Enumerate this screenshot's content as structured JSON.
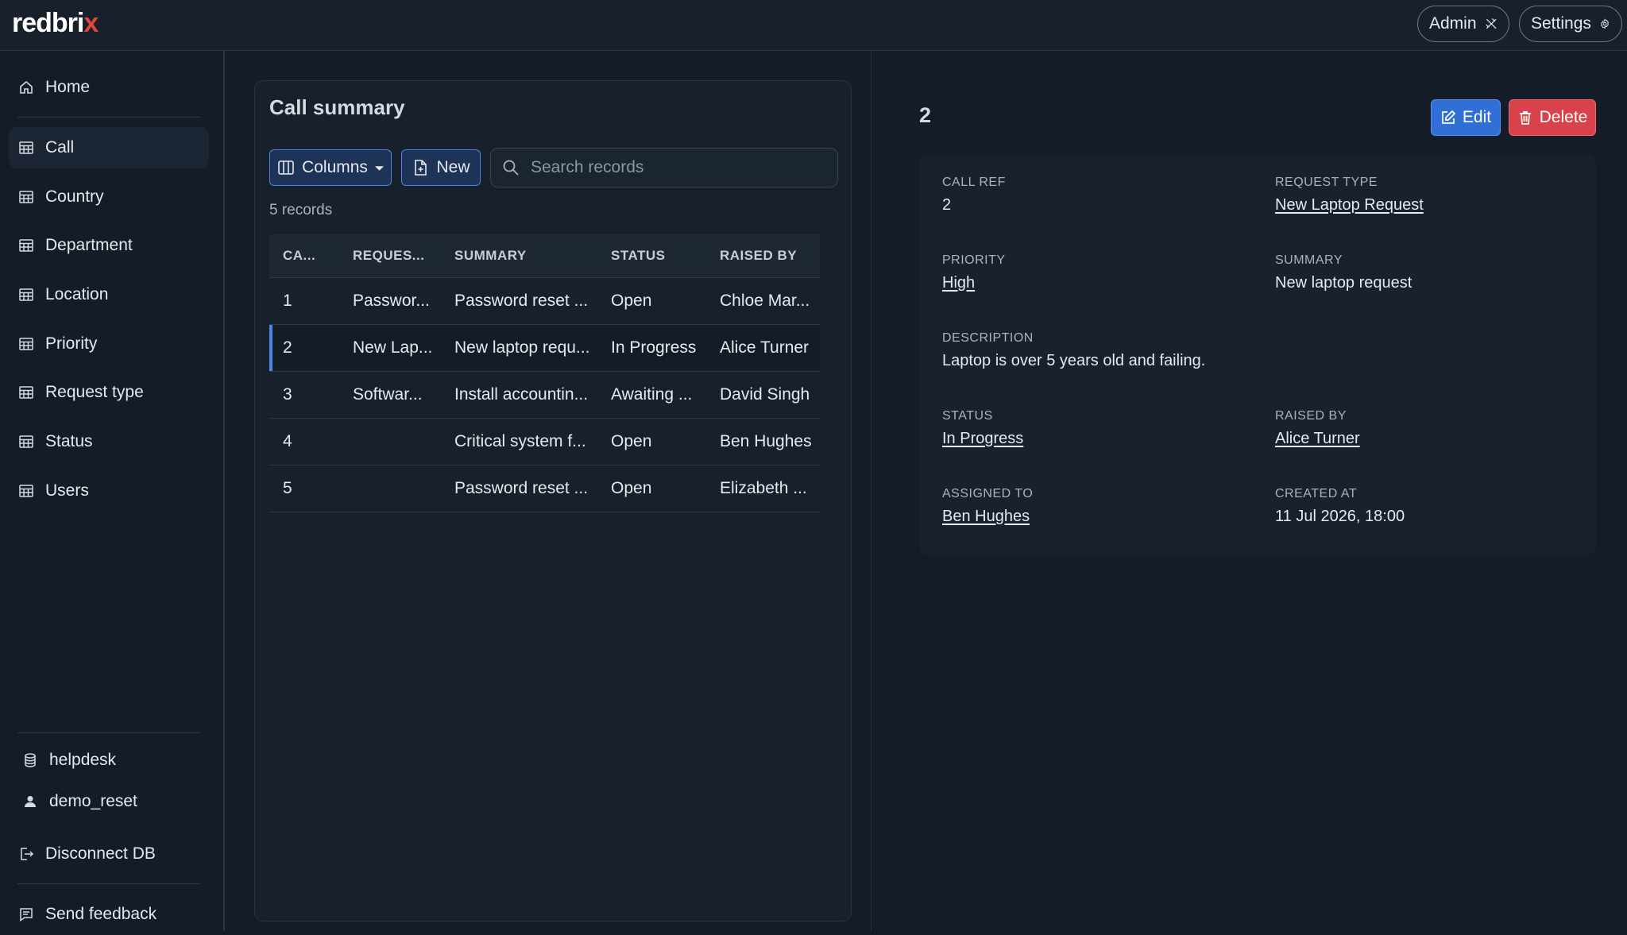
{
  "app": {
    "logo_main": "redbri",
    "logo_accent": "x",
    "admin_label": "Admin",
    "settings_label": "Settings"
  },
  "sidebar": {
    "home": "Home",
    "items": [
      "Call",
      "Country",
      "Department",
      "Location",
      "Priority",
      "Request type",
      "Status",
      "Users"
    ],
    "database": "helpdesk",
    "user": "demo_reset",
    "disconnect": "Disconnect DB",
    "feedback": "Send feedback"
  },
  "list": {
    "title": "Call summary",
    "columns_label": "Columns",
    "new_label": "New",
    "search_placeholder": "Search records",
    "record_count": "5 records",
    "headers": [
      "CA...",
      "REQUES...",
      "SUMMARY",
      "STATUS",
      "RAISED BY"
    ],
    "rows": [
      [
        "1",
        "Passwor...",
        "Password reset ...",
        "Open",
        "Chloe Mar..."
      ],
      [
        "2",
        "New Lap...",
        "New laptop requ...",
        "In Progress",
        "Alice Turner"
      ],
      [
        "3",
        "Softwar...",
        "Install accountin...",
        "Awaiting ...",
        "David Singh"
      ],
      [
        "4",
        "",
        "Critical system f...",
        "Open",
        "Ben Hughes"
      ],
      [
        "5",
        "",
        "Password reset ...",
        "Open",
        "Elizabeth ..."
      ]
    ],
    "selected_row": 1
  },
  "detail": {
    "id": "2",
    "edit_label": "Edit",
    "delete_label": "Delete",
    "fields": {
      "call_ref": {
        "label": "CALL REF",
        "value": "2"
      },
      "request_type": {
        "label": "REQUEST TYPE",
        "value": "New Laptop Request"
      },
      "priority": {
        "label": "PRIORITY",
        "value": "High"
      },
      "summary": {
        "label": "SUMMARY",
        "value": "New laptop request"
      },
      "description": {
        "label": "DESCRIPTION",
        "value": "Laptop is over 5 years old and failing."
      },
      "status": {
        "label": "STATUS",
        "value": "In Progress"
      },
      "raised_by": {
        "label": "RAISED BY",
        "value": "Alice Turner"
      },
      "assigned_to": {
        "label": "ASSIGNED TO",
        "value": "Ben Hughes"
      },
      "created_at": {
        "label": "CREATED AT",
        "value": "11 Jul 2026, 18:00"
      }
    }
  },
  "colors": {
    "accent": "#4a86e8",
    "danger": "#d9424a",
    "brand_accent": "#e0453c",
    "background": "#141c28"
  },
  "icons": {
    "home": "home-icon",
    "table": "table-icon",
    "database": "database-icon",
    "user": "user-icon",
    "disconnect": "logout-icon",
    "feedback": "message-icon",
    "admin": "tools-icon",
    "settings": "gear-icon"
  }
}
